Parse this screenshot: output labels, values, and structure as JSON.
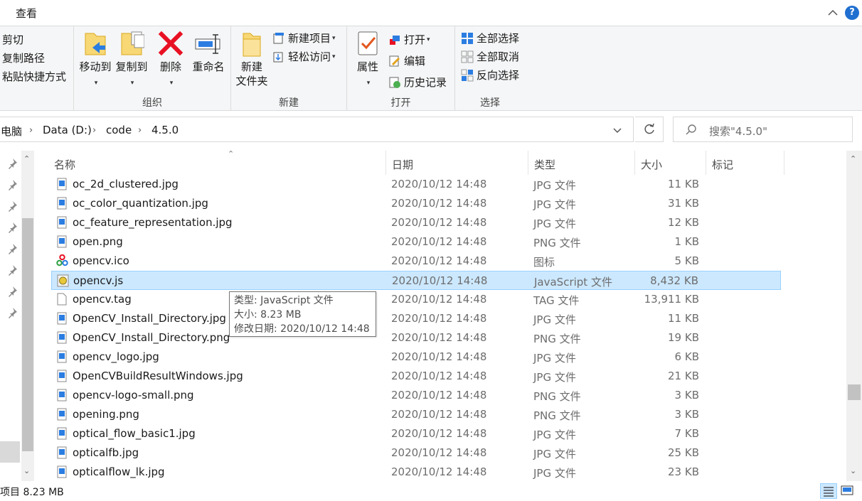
{
  "topbar": {
    "view_tab": "查看",
    "help_label": "?"
  },
  "ribbon": {
    "clipboard": {
      "cut": "剪切",
      "copy_path": "复制路径",
      "paste_shortcut": "粘贴快捷方式"
    },
    "organize": {
      "label": "组织",
      "move_to": "移动到",
      "copy_to": "复制到",
      "delete": "删除",
      "rename": "重命名"
    },
    "new": {
      "label": "新建",
      "new_folder_line1": "新建",
      "new_folder_line2": "文件夹",
      "new_item": "新建项目",
      "easy_access": "轻松访问"
    },
    "open": {
      "label": "打开",
      "properties": "属性",
      "open": "打开",
      "edit": "编辑",
      "history": "历史记录"
    },
    "select": {
      "label": "选择",
      "select_all": "全部选择",
      "select_none": "全部取消",
      "invert": "反向选择"
    }
  },
  "address": {
    "crumbs": [
      "电脑",
      "Data (D:)",
      "code",
      "4.5.0"
    ],
    "search_placeholder": "搜索\"4.5.0\""
  },
  "columns": {
    "name": "名称",
    "date": "日期",
    "type": "类型",
    "size": "大小",
    "tags": "标记"
  },
  "files": [
    {
      "name": "oc_2d_clustered.jpg",
      "date": "2020/10/12 14:48",
      "type": "JPG 文件",
      "size": "11 KB",
      "icon": "image-file-icon"
    },
    {
      "name": "oc_color_quantization.jpg",
      "date": "2020/10/12 14:48",
      "type": "JPG 文件",
      "size": "31 KB",
      "icon": "image-file-icon"
    },
    {
      "name": "oc_feature_representation.jpg",
      "date": "2020/10/12 14:48",
      "type": "JPG 文件",
      "size": "12 KB",
      "icon": "image-file-icon"
    },
    {
      "name": "open.png",
      "date": "2020/10/12 14:48",
      "type": "PNG 文件",
      "size": "1 KB",
      "icon": "image-file-icon"
    },
    {
      "name": "opencv.ico",
      "date": "2020/10/12 14:48",
      "type": "图标",
      "size": "5 KB",
      "icon": "opencv-ico-icon"
    },
    {
      "name": "opencv.js",
      "date": "2020/10/12 14:48",
      "type": "JavaScript 文件",
      "size": "8,432 KB",
      "icon": "js-file-icon",
      "selected": true
    },
    {
      "name": "opencv.tag",
      "date": "2020/10/12 14:48",
      "type": "TAG 文件",
      "size": "13,911 KB",
      "icon": "blank-file-icon"
    },
    {
      "name": "OpenCV_Install_Directory.jpg",
      "date": "2020/10/12 14:48",
      "type": "JPG 文件",
      "size": "11 KB",
      "icon": "image-file-icon"
    },
    {
      "name": "OpenCV_Install_Directory.png",
      "date": "2020/10/12 14:48",
      "type": "PNG 文件",
      "size": "19 KB",
      "icon": "image-file-icon"
    },
    {
      "name": "opencv_logo.jpg",
      "date": "2020/10/12 14:48",
      "type": "JPG 文件",
      "size": "6 KB",
      "icon": "image-file-icon"
    },
    {
      "name": "OpenCVBuildResultWindows.jpg",
      "date": "2020/10/12 14:48",
      "type": "JPG 文件",
      "size": "21 KB",
      "icon": "image-file-icon"
    },
    {
      "name": "opencv-logo-small.png",
      "date": "2020/10/12 14:48",
      "type": "PNG 文件",
      "size": "3 KB",
      "icon": "image-file-icon"
    },
    {
      "name": "opening.png",
      "date": "2020/10/12 14:48",
      "type": "PNG 文件",
      "size": "3 KB",
      "icon": "image-file-icon"
    },
    {
      "name": "optical_flow_basic1.jpg",
      "date": "2020/10/12 14:48",
      "type": "JPG 文件",
      "size": "7 KB",
      "icon": "image-file-icon"
    },
    {
      "name": "opticalfb.jpg",
      "date": "2020/10/12 14:48",
      "type": "JPG 文件",
      "size": "25 KB",
      "icon": "image-file-icon"
    },
    {
      "name": "opticalflow_lk.jpg",
      "date": "2020/10/12 14:48",
      "type": "JPG 文件",
      "size": "23 KB",
      "icon": "image-file-icon"
    }
  ],
  "tooltip": {
    "line1": "类型: JavaScript 文件",
    "line2": "大小: 8.23 MB",
    "line3": "修改日期: 2020/10/12 14:48"
  },
  "status": {
    "text": "项目  8.23 MB"
  },
  "colors": {
    "accent": "#1f6fd0",
    "selection_bg": "#cce8ff",
    "selection_border": "#99d1ff",
    "delete_red": "#e81123",
    "folder_yellow": "#f8d775"
  }
}
